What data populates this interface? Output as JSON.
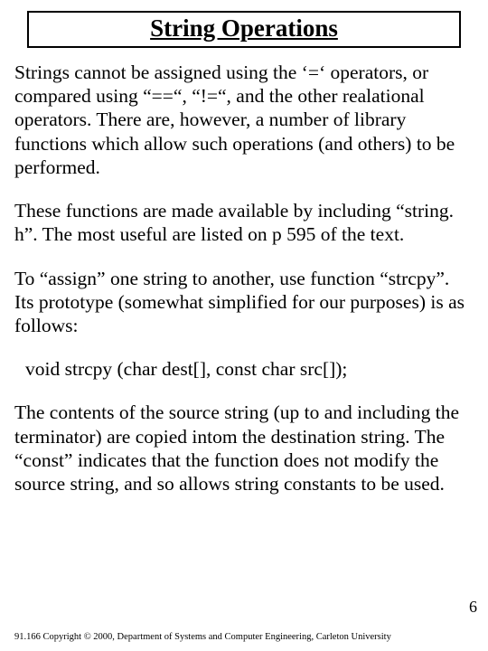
{
  "title": "String Operations",
  "paragraphs": {
    "p1": "Strings cannot be assigned using the ‘=‘ operators, or compared using “==“, “!=“, and the other realational operators.  There are, however, a number of library functions which allow such operations (and others) to be performed.",
    "p2": "These functions are made available by including “string. h”.  The most useful are listed on p 595 of the text.",
    "p3": "To “assign” one string to another, use function “strcpy”.  Its prototype (somewhat simplified for our purposes) is as follows:",
    "proto": "void strcpy (char dest[], const char src[]);",
    "p4": "The contents of the source string (up to and including the terminator) are copied intom the destination string.  The “const” indicates that the function does not modify the source string, and so allows string constants to be used."
  },
  "page_number": "6",
  "footer": "91.166 Copyright © 2000, Department of Systems and Computer Engineering, Carleton University"
}
